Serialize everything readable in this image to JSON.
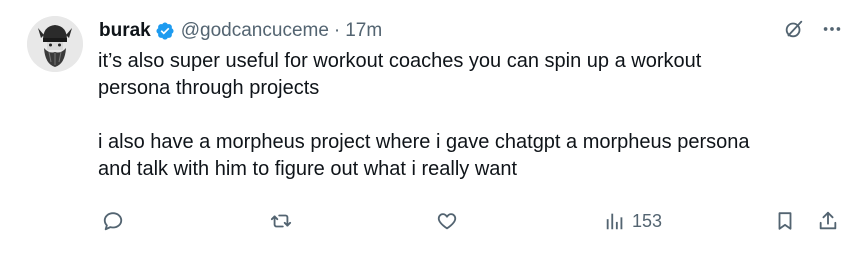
{
  "tweet": {
    "author": {
      "name": "burak",
      "handle": "@godcancuceme",
      "separator": "·",
      "time": "17m"
    },
    "text": {
      "paragraph1_line1": "it’s also super useful for workout coaches you can spin up a workout",
      "paragraph1_line2": "persona through projects",
      "paragraph2_line1": "i also have a morpheus project where i gave chatgpt a morpheus persona",
      "paragraph2_line2": "and talk with him to figure out what i really want"
    },
    "stats": {
      "views": "153"
    }
  },
  "icons": {
    "verified": "verified-badge-icon",
    "grok": "grok-icon",
    "more": "more-icon",
    "reply": "reply-icon",
    "retweet": "retweet-icon",
    "like": "like-icon",
    "views": "views-icon",
    "bookmark": "bookmark-icon",
    "share": "share-icon"
  },
  "colors": {
    "verified": "#1d9bf0",
    "text": "#0f1419",
    "muted": "#536471"
  }
}
